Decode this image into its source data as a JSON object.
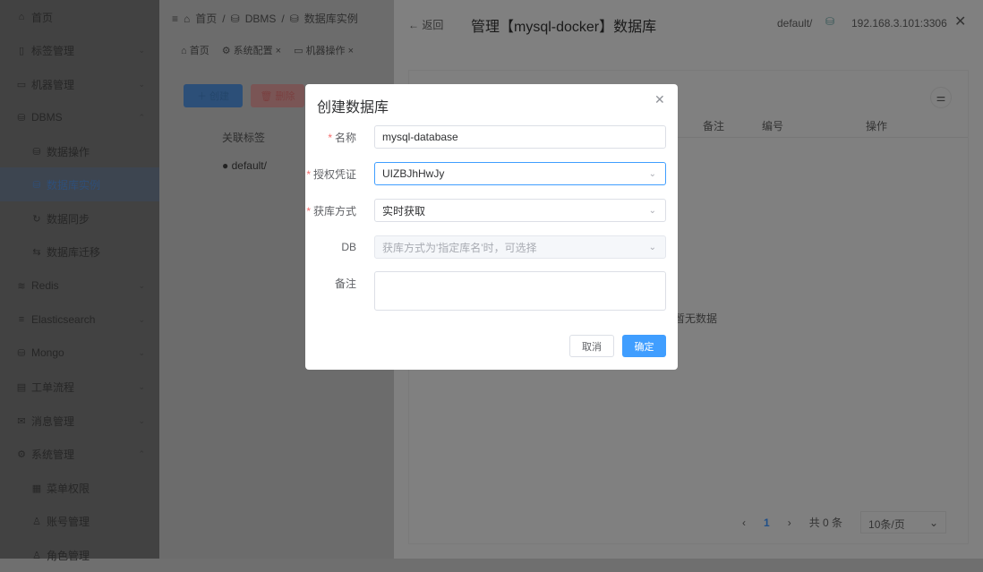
{
  "sidebar": {
    "items": [
      {
        "label": "首页",
        "icon": "home"
      },
      {
        "label": "标签管理",
        "icon": "tag"
      },
      {
        "label": "机器管理",
        "icon": "monitor"
      },
      {
        "label": "DBMS",
        "icon": "database"
      },
      {
        "label": "数据操作",
        "icon": "database"
      },
      {
        "label": "数据库实例",
        "icon": "database"
      },
      {
        "label": "数据同步",
        "icon": "refresh"
      },
      {
        "label": "数据库迁移",
        "icon": "transfer"
      },
      {
        "label": "Redis",
        "icon": "redis"
      },
      {
        "label": "Elasticsearch",
        "icon": "elasticsearch"
      },
      {
        "label": "Mongo",
        "icon": "database"
      },
      {
        "label": "工单流程",
        "icon": "ticket"
      },
      {
        "label": "消息管理",
        "icon": "mail"
      },
      {
        "label": "系统管理",
        "icon": "gear"
      },
      {
        "label": "菜单权限",
        "icon": "grid"
      },
      {
        "label": "账号管理",
        "icon": "user"
      },
      {
        "label": "角色管理",
        "icon": "users"
      }
    ]
  },
  "breadcrumb": [
    "首页",
    "DBMS",
    "数据库实例"
  ],
  "tabs": [
    "首页",
    "系统配置",
    "机器操作"
  ],
  "main": {
    "create": "创建",
    "delete": "删除",
    "col_tag": "关联标签",
    "row_tag": "default/"
  },
  "drawer": {
    "back": "返回",
    "title": "管理【mysql-docker】数据库",
    "tag": "default/",
    "host": "192.168.3.101:3306",
    "columns": [
      "备注",
      "编号",
      "操作"
    ],
    "empty": "暂无数据",
    "pagination": {
      "page": "1",
      "total": "共 0 条",
      "page_size": "10条/页"
    }
  },
  "dialog": {
    "title": "创建数据库",
    "fields": [
      {
        "label": "名称",
        "value": "mysql-database",
        "required": true
      },
      {
        "label": "授权凭证",
        "value": "UIZBJhHwJy",
        "required": true
      },
      {
        "label": "获库方式",
        "value": "实时获取",
        "required": true
      },
      {
        "label": "DB",
        "placeholder": "获库方式为'指定库名'时，可选择",
        "required": false
      },
      {
        "label": "备注",
        "value": "",
        "required": false
      }
    ],
    "cancel": "取消",
    "confirm": "确定"
  },
  "colors": {
    "primary": "#409eff",
    "required": "#f56c6c"
  }
}
